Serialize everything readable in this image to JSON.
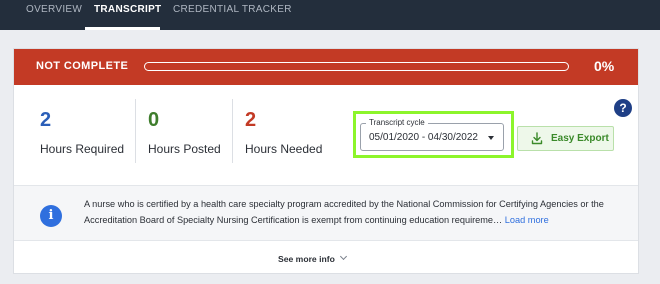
{
  "nav": {
    "tabs": [
      {
        "label": "OVERVIEW",
        "active": false
      },
      {
        "label": "TRANSCRIPT",
        "active": true
      },
      {
        "label": "CREDENTIAL TRACKER",
        "active": false
      }
    ]
  },
  "banner": {
    "status": "NOT COMPLETE",
    "progress_percent": 0,
    "percent_label": "0%",
    "color": "#c33a25"
  },
  "stats": [
    {
      "value": "2",
      "label": "Hours Required",
      "color": "#2b5fb8"
    },
    {
      "value": "0",
      "label": "Hours Posted",
      "color": "#3e7d2c"
    },
    {
      "value": "2",
      "label": "Hours Needed",
      "color": "#c33a25"
    }
  ],
  "transcript_cycle": {
    "legend": "Transcript cycle",
    "value": "05/01/2020 - 04/30/2022"
  },
  "export": {
    "label": "Easy Export",
    "icon": "download-icon"
  },
  "help": {
    "label": "?"
  },
  "info": {
    "icon": "info-icon",
    "text": "A nurse who is certified by a health care specialty program accredited by the National Commission for Certifying Agencies or the Accreditation Board of Specialty Nursing Certification is exempt from continuing education requireme…",
    "link_label": "Load more"
  },
  "see_more": {
    "label": "See more info"
  }
}
